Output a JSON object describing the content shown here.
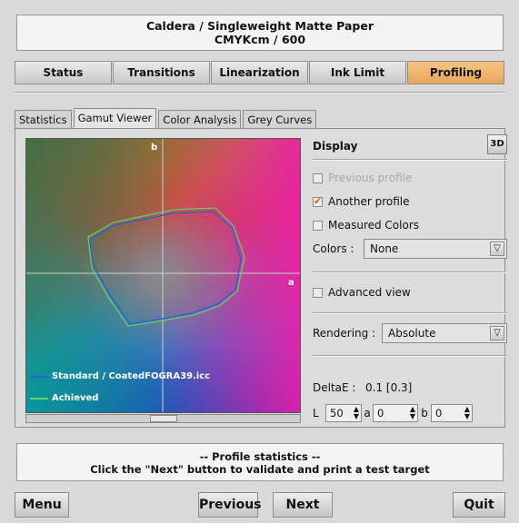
{
  "header": {
    "line1": "Caldera   / Singleweight Matte Paper",
    "line2": "CMYKcm / 600"
  },
  "top_tabs": [
    {
      "label": "Status"
    },
    {
      "label": "Transitions"
    },
    {
      "label": "Linearization"
    },
    {
      "label": "Ink Limit"
    },
    {
      "label": "Profiling",
      "active": true
    }
  ],
  "sub_tabs": [
    {
      "label": "Statistics"
    },
    {
      "label": "Gamut Viewer",
      "active": true
    },
    {
      "label": "Color Analysis"
    },
    {
      "label": "Grey Curves"
    }
  ],
  "chart": {
    "axis_b": "b",
    "axis_a": "a",
    "legend": [
      {
        "label": "Standard / CoatedFOGRA39.icc",
        "color": "#2a5fd8"
      },
      {
        "label": "Achieved",
        "color": "#5fd860"
      }
    ]
  },
  "display": {
    "title": "Display",
    "btn_3d": "3D",
    "previous_profile": "Previous profile",
    "another_profile": "Another profile",
    "measured_colors": "Measured Colors",
    "colors_label": "Colors  :",
    "colors_value": "None",
    "advanced_view": "Advanced view",
    "rendering_label": "Rendering  :",
    "rendering_value": "Absolute",
    "deltae_label": "DeltaE   :",
    "deltae_value": "0.1 [0.3]",
    "l_label": "L",
    "l_value": "50",
    "a_label": "a",
    "a_value": "0",
    "b_label": "b",
    "b_value": "0"
  },
  "footer": {
    "line1": "-- Profile statistics --",
    "line2": "Click the \"Next\" button to validate and print a test target"
  },
  "buttons": {
    "menu": "Menu",
    "previous": "Previous",
    "next": "Next",
    "quit": "Quit"
  },
  "colors": {
    "active_tab": "#f0b46c",
    "check": "#d26a14"
  }
}
